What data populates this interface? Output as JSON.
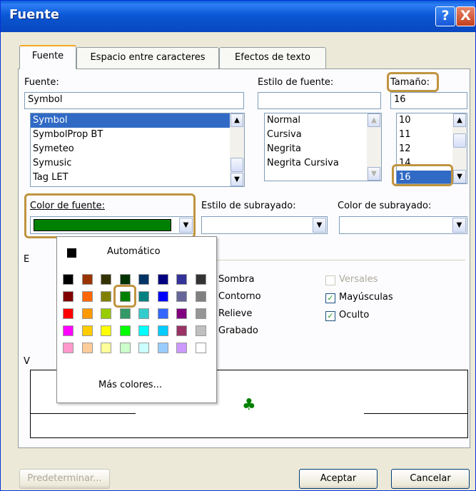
{
  "dialog": {
    "title": "Fuente",
    "help_button": "?",
    "close_button": "X"
  },
  "tabs": [
    "Fuente",
    "Espacio entre caracteres",
    "Efectos de texto"
  ],
  "font": {
    "label": "Fuente:",
    "value": "Symbol",
    "items": [
      "Symbol",
      "SymbolProp BT",
      "Symeteo",
      "Symusic",
      "Tag LET"
    ],
    "selected_index": 0
  },
  "style": {
    "label": "Estilo de fuente:",
    "value": "",
    "items": [
      "Normal",
      "Cursiva",
      "Negrita",
      "Negrita Cursiva"
    ]
  },
  "size": {
    "label": "Tamaño:",
    "value": "16",
    "items": [
      "10",
      "11",
      "12",
      "14",
      "16"
    ],
    "selected": "16"
  },
  "font_color": {
    "label": "Color de fuente:",
    "value_color": "#008000"
  },
  "underline_style": {
    "label": "Estilo de subrayado:"
  },
  "underline_color": {
    "label": "Color de subrayado:"
  },
  "color_popup": {
    "automatic_label": "Automático",
    "more_colors_label": "Más colores...",
    "selected_row": 1,
    "selected_col": 3,
    "rows": [
      [
        "#000000",
        "#993300",
        "#333300",
        "#003300",
        "#003366",
        "#000080",
        "#333399",
        "#333333"
      ],
      [
        "#800000",
        "#ff6600",
        "#808000",
        "#008000",
        "#008080",
        "#0000ff",
        "#666699",
        "#808080"
      ],
      [
        "#ff0000",
        "#ff9900",
        "#99cc00",
        "#339966",
        "#33cccc",
        "#3366ff",
        "#800080",
        "#969696"
      ],
      [
        "#ff00ff",
        "#ffcc00",
        "#ffff00",
        "#00ff00",
        "#00ffff",
        "#00ccff",
        "#993366",
        "#c0c0c0"
      ],
      [
        "#ff99cc",
        "#ffcc99",
        "#ffff99",
        "#ccffcc",
        "#ccffff",
        "#99ccff",
        "#cc99ff",
        "#ffffff"
      ]
    ]
  },
  "effects": {
    "partial_left": "E",
    "left": [
      "Sombra",
      "Contorno",
      "Relieve",
      "Grabado"
    ],
    "right": [
      {
        "label": "Versales",
        "checked": false,
        "enabled": false
      },
      {
        "label": "Mayúsculas",
        "checked": true,
        "enabled": true
      },
      {
        "label": "Oculto",
        "checked": true,
        "enabled": true
      }
    ]
  },
  "preview": {
    "partial_label": "V",
    "glyph": "♣",
    "glyph_color": "#008000"
  },
  "buttons": {
    "default": "Predeterminar...",
    "ok": "Aceptar",
    "cancel": "Cancelar"
  }
}
